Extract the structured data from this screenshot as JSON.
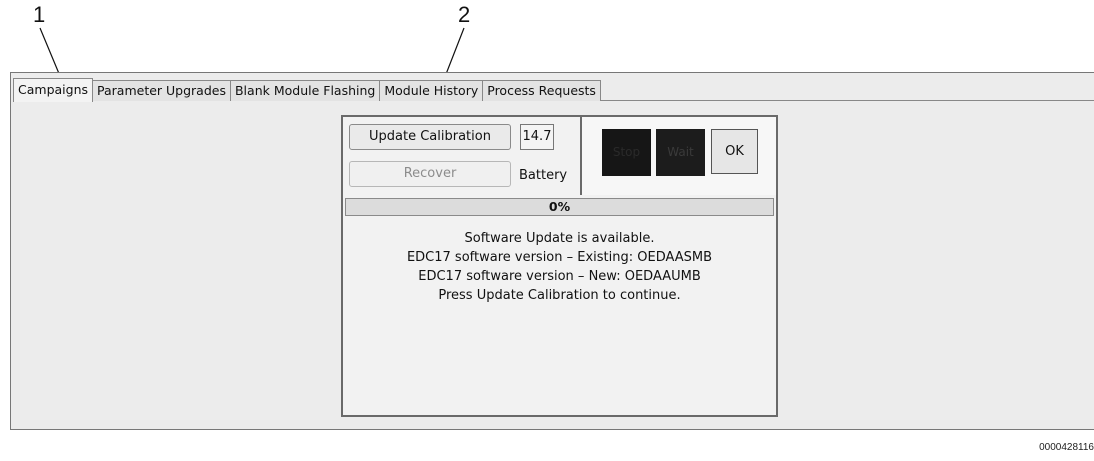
{
  "callouts": [
    "1",
    "2"
  ],
  "tabs": [
    {
      "label": "Campaigns",
      "active": true
    },
    {
      "label": "Parameter Upgrades",
      "active": false
    },
    {
      "label": "Blank Module Flashing",
      "active": false
    },
    {
      "label": "Module History",
      "active": false
    },
    {
      "label": "Process Requests",
      "active": false
    }
  ],
  "panel": {
    "update_button": "Update Calibration",
    "recover_button": "Recover",
    "voltage": "14.7",
    "battery_label": "Battery",
    "lights": {
      "stop": "Stop",
      "wait": "Wait",
      "ok": "OK"
    },
    "progress_percent": 0,
    "progress_text": "0%",
    "messages": [
      "Software Update is available.",
      "EDC17 software version – Existing: OEDAASMB",
      "EDC17 software version – New: OEDAAUMB",
      "Press Update Calibration to continue."
    ]
  },
  "figure_id": "0000428116",
  "colors": {
    "window_bg": "#ececec",
    "light_dark": "#161616"
  }
}
